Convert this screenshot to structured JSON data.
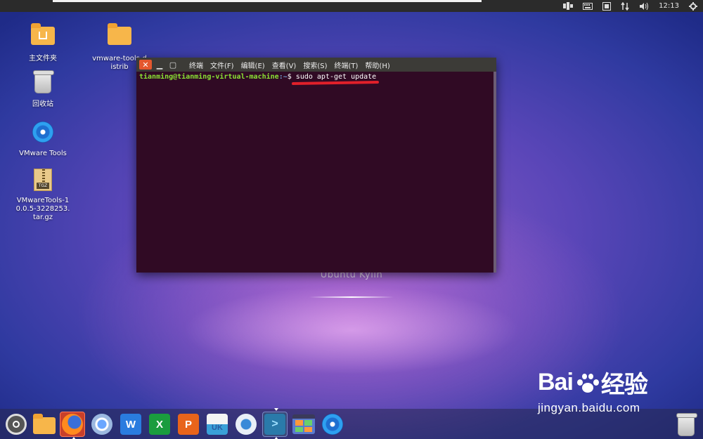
{
  "top_panel": {
    "clock": "12:13"
  },
  "desktop_icons": [
    {
      "label": "主文件夹"
    },
    {
      "label": "vmware-tools-distrib"
    },
    {
      "label": "回收站"
    },
    {
      "label": "VMware Tools"
    },
    {
      "label": "VMwareTools-10.0.5-3228253.tar.gz",
      "badge": "TGZ"
    }
  ],
  "terminal": {
    "menu": [
      "终端",
      "文件(F)",
      "编辑(E)",
      "查看(V)",
      "搜索(S)",
      "终端(T)",
      "帮助(H)"
    ],
    "prompt_user": "tianming@tianming-virtual-machine",
    "prompt_path": ":~",
    "prompt_symbol": "$",
    "command": "sudo apt-get update",
    "highlight_color": "#e0202a",
    "background_color": "#300a24"
  },
  "wallpaper": {
    "brand": "Ubuntu Kylin"
  },
  "dock": {
    "items": [
      {
        "icon": "ubuntu-kylin-start-icon"
      },
      {
        "icon": "files-folder-icon"
      },
      {
        "icon": "firefox-icon"
      },
      {
        "icon": "chromium-browser-icon"
      },
      {
        "icon": "wps-writer-icon",
        "glyph": "W"
      },
      {
        "icon": "wps-spreadsheets-icon",
        "glyph": "X"
      },
      {
        "icon": "wps-presentation-icon",
        "glyph": "P"
      },
      {
        "icon": "software-center-icon",
        "glyph": "UK"
      },
      {
        "icon": "mail-client-icon"
      },
      {
        "icon": "terminal-icon",
        "glyph": ">"
      },
      {
        "icon": "workspace-switcher-icon"
      },
      {
        "icon": "vmware-tools-disc-icon"
      },
      {
        "icon": "trash-icon"
      }
    ]
  },
  "watermark": {
    "logo_left": "Bai",
    "logo_right": "经验",
    "url": "jingyan.baidu.com"
  }
}
